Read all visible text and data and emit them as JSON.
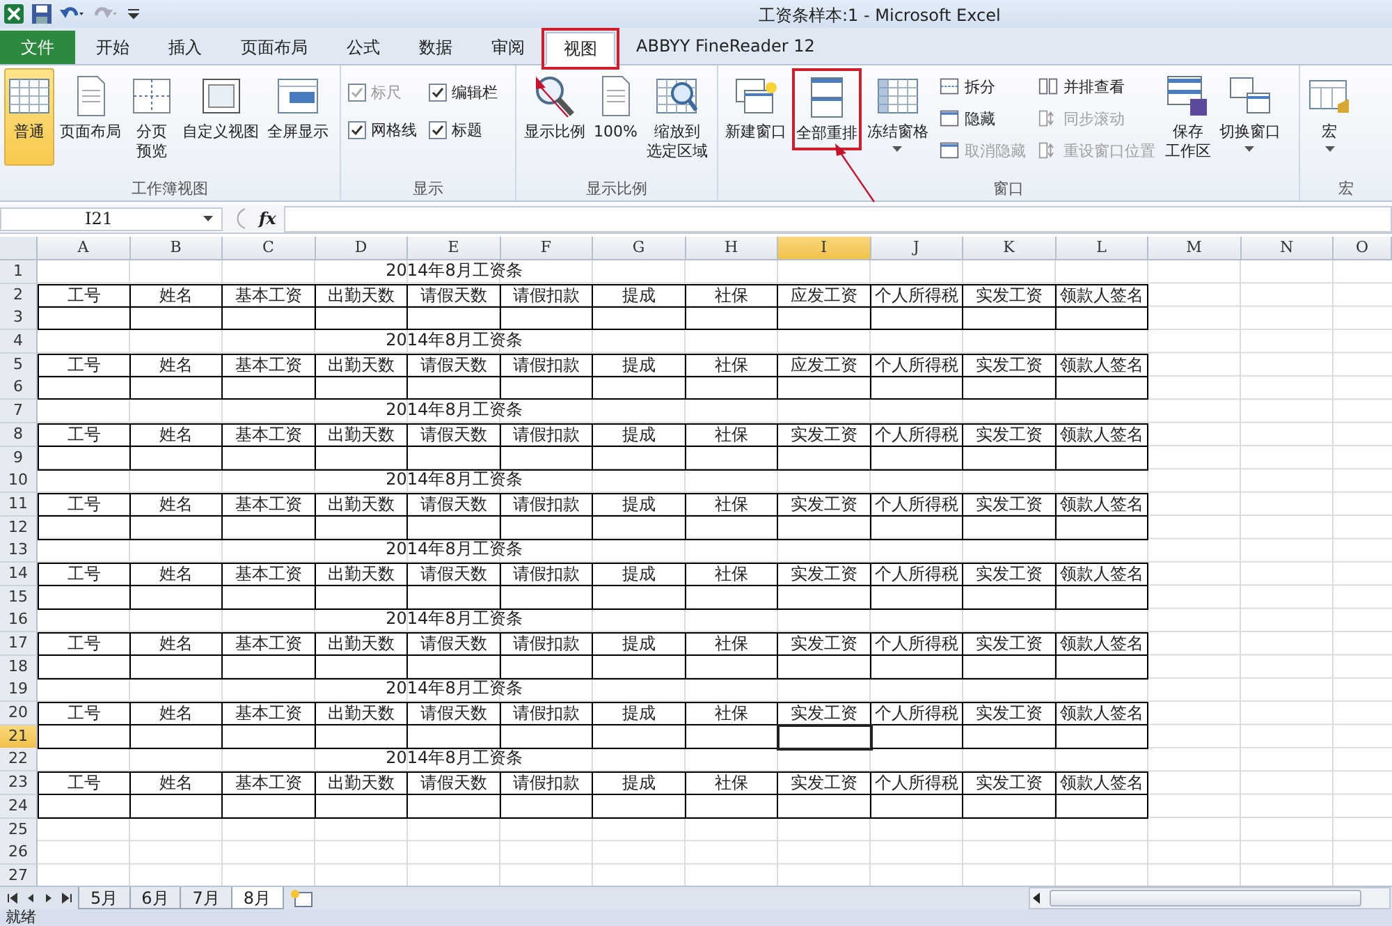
{
  "window": {
    "title": "工资条样本:1 - Microsoft Excel"
  },
  "tabs": [
    {
      "label": "文件",
      "kind": "file",
      "selected": false,
      "annotated": false
    },
    {
      "label": "开始",
      "kind": "tab",
      "selected": false,
      "annotated": false
    },
    {
      "label": "插入",
      "kind": "tab",
      "selected": false,
      "annotated": false
    },
    {
      "label": "页面布局",
      "kind": "tab",
      "selected": false,
      "annotated": false
    },
    {
      "label": "公式",
      "kind": "tab",
      "selected": false,
      "annotated": false
    },
    {
      "label": "数据",
      "kind": "tab",
      "selected": false,
      "annotated": false
    },
    {
      "label": "审阅",
      "kind": "tab",
      "selected": false,
      "annotated": false
    },
    {
      "label": "视图",
      "kind": "tab",
      "selected": true,
      "annotated": true
    },
    {
      "label": "ABBYY FineReader 12",
      "kind": "tab",
      "selected": false,
      "annotated": false
    }
  ],
  "ribbon": {
    "groups": [
      {
        "label": "工作簿视图",
        "items": [
          {
            "kind": "view",
            "label": "普通",
            "selected": true,
            "annotated": false
          },
          {
            "kind": "view",
            "label": "页面布局",
            "selected": false,
            "annotated": false
          },
          {
            "kind": "view",
            "label": "分页预览",
            "selected": false,
            "annotated": false
          },
          {
            "kind": "large",
            "label": "自定义视图",
            "annotated": false
          },
          {
            "kind": "large",
            "label": "全屏显示",
            "annotated": false
          }
        ]
      },
      {
        "label": "显示",
        "items": [
          {
            "kind": "checks",
            "items": [
              {
                "label": "标尺",
                "checked": true,
                "disabled": true
              },
              {
                "label": "编辑栏",
                "checked": true,
                "disabled": false
              },
              {
                "label": "网格线",
                "checked": true,
                "disabled": false
              },
              {
                "label": "标题",
                "checked": true,
                "disabled": false
              }
            ]
          }
        ]
      },
      {
        "label": "显示比例",
        "items": [
          {
            "kind": "large",
            "label": "显示比例",
            "annotated": false
          },
          {
            "kind": "large",
            "label": "100%",
            "annotated": false
          },
          {
            "kind": "large",
            "label": "缩放到选定区域",
            "annotated": false
          }
        ]
      },
      {
        "label": "窗口",
        "items": [
          {
            "kind": "large",
            "label": "新建窗口",
            "annotated": false
          },
          {
            "kind": "large",
            "label": "全部重排",
            "annotated": true
          },
          {
            "kind": "menu",
            "label": "冻结窗格",
            "annotated": false
          },
          {
            "kind": "stack",
            "items": [
              {
                "label": "拆分",
                "disabled": false
              },
              {
                "label": "隐藏",
                "disabled": false
              },
              {
                "label": "取消隐藏",
                "disabled": true
              }
            ]
          },
          {
            "kind": "stack",
            "items": [
              {
                "label": "并排查看",
                "disabled": false
              },
              {
                "label": "同步滚动",
                "disabled": true
              },
              {
                "label": "重设窗口位置",
                "disabled": true
              }
            ]
          },
          {
            "kind": "large",
            "label": "保存工作区",
            "annotated": false
          },
          {
            "kind": "menu",
            "label": "切换窗口",
            "annotated": false
          }
        ]
      },
      {
        "label": "宏",
        "items": [
          {
            "kind": "menu",
            "label": "宏",
            "annotated": false
          }
        ]
      }
    ]
  },
  "formula_bar": {
    "name_box": "I21",
    "function_label": "fx"
  },
  "columns": [
    {
      "label": "A",
      "selected": false
    },
    {
      "label": "B",
      "selected": false
    },
    {
      "label": "C",
      "selected": false
    },
    {
      "label": "D",
      "selected": false
    },
    {
      "label": "E",
      "selected": false
    },
    {
      "label": "F",
      "selected": false
    },
    {
      "label": "G",
      "selected": false
    },
    {
      "label": "H",
      "selected": false
    },
    {
      "label": "I",
      "selected": true
    },
    {
      "label": "J",
      "selected": false
    },
    {
      "label": "K",
      "selected": false
    },
    {
      "label": "L",
      "selected": false
    },
    {
      "label": "M",
      "selected": false
    },
    {
      "label": "N",
      "selected": false
    },
    {
      "label": "O",
      "selected": false
    }
  ],
  "rows": [
    {
      "number": "1",
      "selected": false,
      "kind": "title",
      "text": "2014年8月工资条"
    },
    {
      "number": "2",
      "selected": false,
      "kind": "header",
      "cells": [
        "工号",
        "姓名",
        "基本工资",
        "出勤天数",
        "请假天数",
        "请假扣款",
        "提成",
        "社保",
        "应发工资",
        "个人所得税",
        "实发工资",
        "领款人签名"
      ]
    },
    {
      "number": "3",
      "selected": false,
      "kind": "blank"
    },
    {
      "number": "4",
      "selected": false,
      "kind": "title",
      "text": "2014年8月工资条"
    },
    {
      "number": "5",
      "selected": false,
      "kind": "header",
      "cells": [
        "工号",
        "姓名",
        "基本工资",
        "出勤天数",
        "请假天数",
        "请假扣款",
        "提成",
        "社保",
        "应发工资",
        "个人所得税",
        "实发工资",
        "领款人签名"
      ]
    },
    {
      "number": "6",
      "selected": false,
      "kind": "blank"
    },
    {
      "number": "7",
      "selected": false,
      "kind": "title",
      "text": "2014年8月工资条"
    },
    {
      "number": "8",
      "selected": false,
      "kind": "header",
      "cells": [
        "工号",
        "姓名",
        "基本工资",
        "出勤天数",
        "请假天数",
        "请假扣款",
        "提成",
        "社保",
        "实发工资",
        "个人所得税",
        "实发工资",
        "领款人签名"
      ]
    },
    {
      "number": "9",
      "selected": false,
      "kind": "blank"
    },
    {
      "number": "10",
      "selected": false,
      "kind": "title",
      "text": "2014年8月工资条"
    },
    {
      "number": "11",
      "selected": false,
      "kind": "header",
      "cells": [
        "工号",
        "姓名",
        "基本工资",
        "出勤天数",
        "请假天数",
        "请假扣款",
        "提成",
        "社保",
        "实发工资",
        "个人所得税",
        "实发工资",
        "领款人签名"
      ]
    },
    {
      "number": "12",
      "selected": false,
      "kind": "blank"
    },
    {
      "number": "13",
      "selected": false,
      "kind": "title",
      "text": "2014年8月工资条"
    },
    {
      "number": "14",
      "selected": false,
      "kind": "header",
      "cells": [
        "工号",
        "姓名",
        "基本工资",
        "出勤天数",
        "请假天数",
        "请假扣款",
        "提成",
        "社保",
        "实发工资",
        "个人所得税",
        "实发工资",
        "领款人签名"
      ]
    },
    {
      "number": "15",
      "selected": false,
      "kind": "blank"
    },
    {
      "number": "16",
      "selected": false,
      "kind": "title",
      "text": "2014年8月工资条"
    },
    {
      "number": "17",
      "selected": false,
      "kind": "header",
      "cells": [
        "工号",
        "姓名",
        "基本工资",
        "出勤天数",
        "请假天数",
        "请假扣款",
        "提成",
        "社保",
        "实发工资",
        "个人所得税",
        "实发工资",
        "领款人签名"
      ]
    },
    {
      "number": "18",
      "selected": false,
      "kind": "blank"
    },
    {
      "number": "19",
      "selected": false,
      "kind": "title",
      "text": "2014年8月工资条"
    },
    {
      "number": "20",
      "selected": false,
      "kind": "header",
      "cells": [
        "工号",
        "姓名",
        "基本工资",
        "出勤天数",
        "请假天数",
        "请假扣款",
        "提成",
        "社保",
        "实发工资",
        "个人所得税",
        "实发工资",
        "领款人签名"
      ]
    },
    {
      "number": "21",
      "selected": true,
      "kind": "blank"
    },
    {
      "number": "22",
      "selected": false,
      "kind": "title",
      "text": "2014年8月工资条"
    },
    {
      "number": "23",
      "selected": false,
      "kind": "header",
      "cells": [
        "工号",
        "姓名",
        "基本工资",
        "出勤天数",
        "请假天数",
        "请假扣款",
        "提成",
        "社保",
        "实发工资",
        "个人所得税",
        "实发工资",
        "领款人签名"
      ]
    },
    {
      "number": "24",
      "selected": false,
      "kind": "blank"
    },
    {
      "number": "25",
      "selected": false,
      "kind": "empty"
    },
    {
      "number": "26",
      "selected": false,
      "kind": "empty"
    },
    {
      "number": "27",
      "selected": false,
      "kind": "empty"
    }
  ],
  "sheet_tabs": [
    {
      "label": "5月",
      "selected": false
    },
    {
      "label": "6月",
      "selected": false
    },
    {
      "label": "7月",
      "selected": false
    },
    {
      "label": "8月",
      "selected": true
    }
  ],
  "status_bar": {
    "text": "就绪"
  }
}
